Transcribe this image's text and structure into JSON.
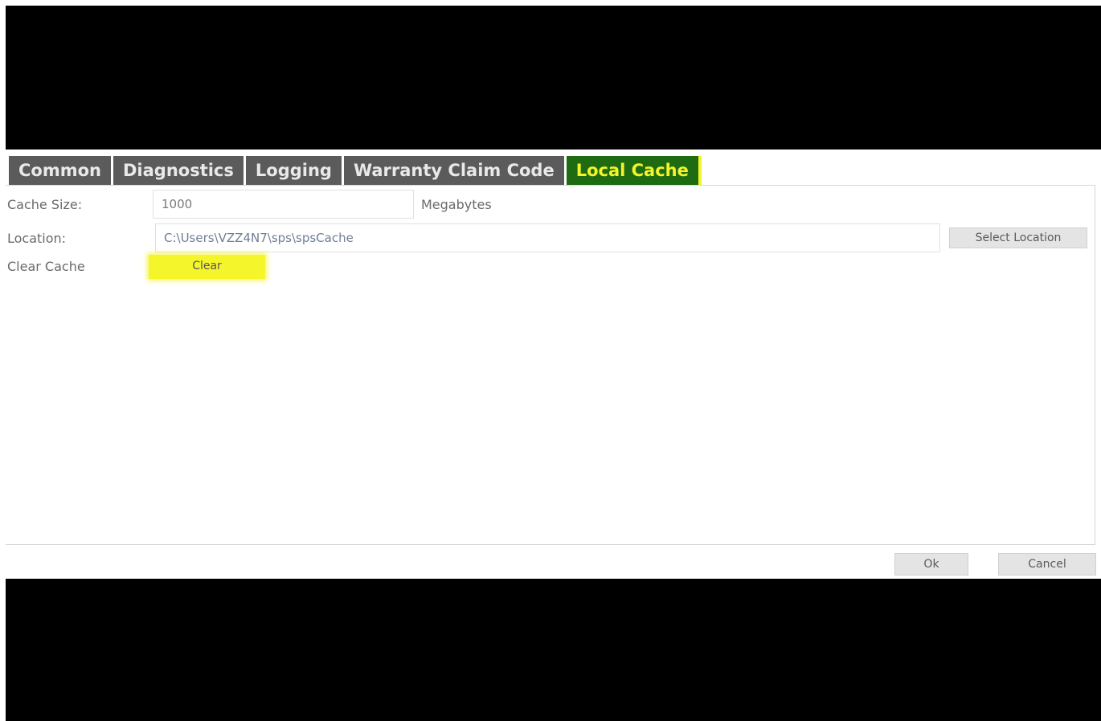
{
  "tabs": [
    {
      "label": "Common",
      "active": false
    },
    {
      "label": "Diagnostics",
      "active": false
    },
    {
      "label": "Logging",
      "active": false
    },
    {
      "label": "Warranty Claim Code",
      "active": false
    },
    {
      "label": "Local Cache",
      "active": true
    }
  ],
  "cache_size": {
    "label": "Cache Size:",
    "value": "1000",
    "units": "Megabytes"
  },
  "location": {
    "label": "Location:",
    "value": "C:\\Users\\VZZ4N7\\sps\\spsCache",
    "button_label": "Select Location"
  },
  "clear_cache": {
    "label": "Clear Cache",
    "button_label": "Clear"
  },
  "footer": {
    "ok_label": "Ok",
    "cancel_label": "Cancel"
  },
  "colors": {
    "active_tab_bg": "#1f6b12",
    "active_tab_text": "#f2f52a",
    "highlight": "#f5f52c",
    "tab_bg": "#5b5b5b"
  }
}
